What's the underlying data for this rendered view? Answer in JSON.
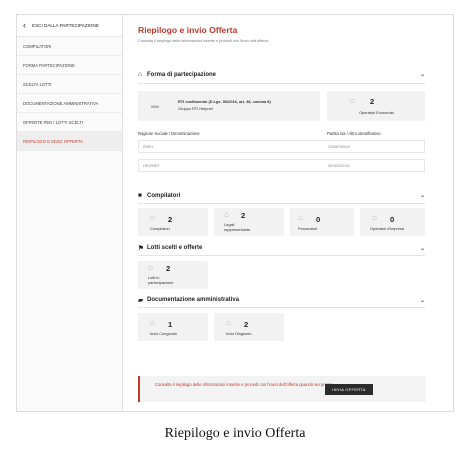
{
  "sidebar": {
    "back_label": "ESCI DALLA PARTECIPAZIONE",
    "items": [
      {
        "label": "COMPILATORI"
      },
      {
        "label": "FORMA PARTECIPAZIONE"
      },
      {
        "label": "SCELTA LOTTI"
      },
      {
        "label": "DOCUMENTAZIONE AMMINISTRATIVA"
      },
      {
        "label": "OFFERTE PER I LOTTI SCELTI"
      },
      {
        "label": "RIEPILOGO E INVIO OFFERTA"
      }
    ],
    "active_index": 5
  },
  "page": {
    "title": "Riepilogo e invio Offerta",
    "subtitle": "Consulta il riepilogo delle informazioni inserite e procedi con l'invio dell'offerta."
  },
  "forma": {
    "heading": "Forma di partecipazione",
    "rti_line1": "RTI costituendo (D.Lgs. 50/2016, art. 48, comma 8)",
    "rti_line2": "Gruppo RTI Helpnet",
    "operatori_count": "2",
    "operatori_label": "Operatori Economici",
    "table_headers": [
      "Ragione Sociale / Denominazione",
      "Partita Iva / Altro identificativo"
    ],
    "rows": [
      {
        "name": "RIGEL",
        "piva": "23456789012"
      },
      {
        "name": "HELPNET",
        "piva": "98765432101"
      }
    ]
  },
  "compilatori": {
    "heading": "Compilatori",
    "cards": [
      {
        "value": "2",
        "label": "Compilatori"
      },
      {
        "value": "2",
        "label": "Legali rappresentante"
      },
      {
        "value": "0",
        "label": "Procuratori"
      },
      {
        "value": "0",
        "label": "Operatori d'impresa"
      }
    ]
  },
  "lotti": {
    "heading": "Lotti scelti e offerte",
    "cards": [
      {
        "value": "2",
        "label": "Lotti in partecipazione"
      }
    ]
  },
  "documentazione": {
    "heading": "Documentazione amministrativa",
    "cards": [
      {
        "value": "1",
        "label": "Invio Congiunto"
      },
      {
        "value": "2",
        "label": "Invio Disgiunto"
      }
    ]
  },
  "footer": {
    "text": "Consulta il riepilogo delle informazioni inserite e procedi con l'invio dell'offerta quando sei pronto.",
    "button_label": "INVIA OFFERTA"
  },
  "caption": "Riepilogo e invio Offerta",
  "colors": {
    "accent": "#c0392b",
    "card_bg": "#f2f2f2",
    "button_bg": "#2c2c2c"
  }
}
